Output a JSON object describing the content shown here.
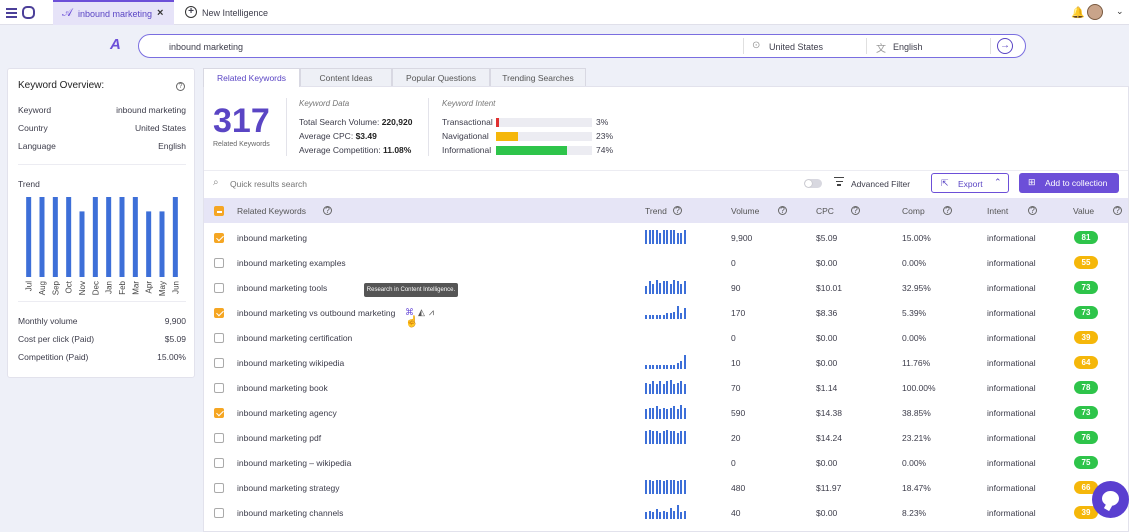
{
  "topbar": {
    "tab_label": "inbound marketing",
    "tab_close": "×",
    "new_label": "New Intelligence"
  },
  "search": {
    "query": "inbound marketing",
    "country": "United States",
    "language": "English"
  },
  "overview": {
    "title": "Keyword Overview:",
    "keyword_label": "Keyword",
    "keyword_value": "inbound marketing",
    "country_label": "Country",
    "country_value": "United States",
    "language_label": "Language",
    "language_value": "English",
    "trend_label": "Trend",
    "monthly_label": "Monthly volume",
    "monthly_value": "9,900",
    "cpc_label": "Cost per click (Paid)",
    "cpc_value": "$5.09",
    "comp_label": "Competition (Paid)",
    "comp_value": "15.00%"
  },
  "chart_data": {
    "type": "bar",
    "categories": [
      "Jul",
      "Aug",
      "Sep",
      "Oct",
      "Nov",
      "Dec",
      "Jan",
      "Feb",
      "Mar",
      "Apr",
      "May",
      "Jun"
    ],
    "values": [
      100,
      100,
      100,
      100,
      82,
      100,
      100,
      100,
      100,
      82,
      82,
      100
    ],
    "ylim": [
      0,
      100
    ],
    "color": "#3d6fd8"
  },
  "tabs": [
    {
      "label": "Related Keywords"
    },
    {
      "label": "Content Ideas"
    },
    {
      "label": "Popular Questions"
    },
    {
      "label": "Trending Searches"
    }
  ],
  "summary": {
    "count": "317",
    "count_label": "Related Keywords",
    "kd_title": "Keyword Data",
    "tsv_label": "Total Search Volume:",
    "tsv_value": "220,920",
    "cpc_label": "Average CPC:",
    "cpc_value": "$3.49",
    "comp_label": "Average Competition:",
    "comp_value": "11.08%",
    "ki_title": "Keyword Intent",
    "intents": [
      {
        "label": "Transactional",
        "pct": "3%",
        "value": 3,
        "color": "#e03030"
      },
      {
        "label": "Navigational",
        "pct": "23%",
        "value": 23,
        "color": "#f5b70a"
      },
      {
        "label": "Informational",
        "pct": "74%",
        "value": 74,
        "color": "#2ec44a"
      }
    ]
  },
  "toolbar": {
    "search_placeholder": "Quick results search",
    "advanced_filter": "Advanced Filter",
    "export": "Export",
    "add_collection": "Add to collection"
  },
  "table": {
    "headers": {
      "keywords": "Related Keywords",
      "trend": "Trend",
      "volume": "Volume",
      "cpc": "CPC",
      "comp": "Comp",
      "intent": "Intent",
      "value": "Value"
    },
    "rows": [
      {
        "keyword": "inbound marketing",
        "checked": true,
        "trend": [
          10,
          10,
          10,
          10,
          8,
          10,
          10,
          10,
          10,
          8,
          8,
          10
        ],
        "volume": "9,900",
        "cpc": "$5.09",
        "comp": "15.00%",
        "intent": "informational",
        "value": "81",
        "color": "#2ec44a"
      },
      {
        "keyword": "inbound marketing examples",
        "checked": false,
        "trend": [],
        "volume": "0",
        "cpc": "$0.00",
        "comp": "0.00%",
        "intent": "informational",
        "value": "55",
        "color": "#f5b70a"
      },
      {
        "keyword": "inbound marketing tools",
        "checked": false,
        "trend": [
          6,
          9,
          7,
          10,
          8,
          9,
          9,
          7,
          10,
          9,
          7,
          9
        ],
        "volume": "90",
        "cpc": "$10.01",
        "comp": "32.95%",
        "intent": "informational",
        "value": "73",
        "color": "#2ec44a"
      },
      {
        "keyword": "inbound marketing vs outbound marketing",
        "checked": true,
        "trend": [
          3,
          3,
          3,
          3,
          3,
          3,
          4,
          4,
          5,
          9,
          4,
          8
        ],
        "volume": "170",
        "cpc": "$8.36",
        "comp": "5.39%",
        "intent": "informational",
        "value": "73",
        "color": "#2ec44a"
      },
      {
        "keyword": "inbound marketing certification",
        "checked": false,
        "trend": [],
        "volume": "0",
        "cpc": "$0.00",
        "comp": "0.00%",
        "intent": "informational",
        "value": "39",
        "color": "#f5b70a"
      },
      {
        "keyword": "inbound marketing wikipedia",
        "checked": false,
        "trend": [
          3,
          3,
          3,
          3,
          3,
          3,
          3,
          3,
          3,
          4,
          6,
          10
        ],
        "volume": "10",
        "cpc": "$0.00",
        "comp": "11.76%",
        "intent": "informational",
        "value": "64",
        "color": "#f5b70a"
      },
      {
        "keyword": "inbound marketing book",
        "checked": false,
        "trend": [
          8,
          7,
          9,
          7,
          9,
          7,
          9,
          10,
          7,
          8,
          9,
          7
        ],
        "volume": "70",
        "cpc": "$1.14",
        "comp": "100.00%",
        "intent": "informational",
        "value": "78",
        "color": "#2ec44a"
      },
      {
        "keyword": "inbound marketing agency",
        "checked": true,
        "trend": [
          7,
          8,
          8,
          9,
          7,
          8,
          7,
          8,
          9,
          7,
          10,
          8
        ],
        "volume": "590",
        "cpc": "$14.38",
        "comp": "38.85%",
        "intent": "informational",
        "value": "73",
        "color": "#2ec44a"
      },
      {
        "keyword": "inbound marketing pdf",
        "checked": false,
        "trend": [
          9,
          10,
          9,
          9,
          8,
          9,
          10,
          9,
          9,
          8,
          9,
          9
        ],
        "volume": "20",
        "cpc": "$14.24",
        "comp": "23.21%",
        "intent": "informational",
        "value": "76",
        "color": "#2ec44a"
      },
      {
        "keyword": "inbound marketing – wikipedia",
        "checked": false,
        "trend": [],
        "volume": "0",
        "cpc": "$0.00",
        "comp": "0.00%",
        "intent": "informational",
        "value": "75",
        "color": "#2ec44a"
      },
      {
        "keyword": "inbound marketing strategy",
        "checked": false,
        "trend": [
          10,
          10,
          9,
          10,
          10,
          9,
          10,
          10,
          10,
          9,
          10,
          10
        ],
        "volume": "480",
        "cpc": "$11.97",
        "comp": "18.47%",
        "intent": "informational",
        "value": "66",
        "color": "#f5b70a"
      },
      {
        "keyword": "inbound marketing channels",
        "checked": false,
        "trend": [
          5,
          6,
          5,
          7,
          5,
          6,
          5,
          8,
          6,
          10,
          5,
          6
        ],
        "volume": "40",
        "cpc": "$0.00",
        "comp": "8.23%",
        "intent": "informational",
        "value": "39",
        "color": "#f5b70a"
      }
    ]
  },
  "tooltip": "Research in Content Intelligence.",
  "colors": {
    "accent": "#6c4fd8",
    "bar": "#3d6fd8",
    "check": "#f5a623"
  }
}
